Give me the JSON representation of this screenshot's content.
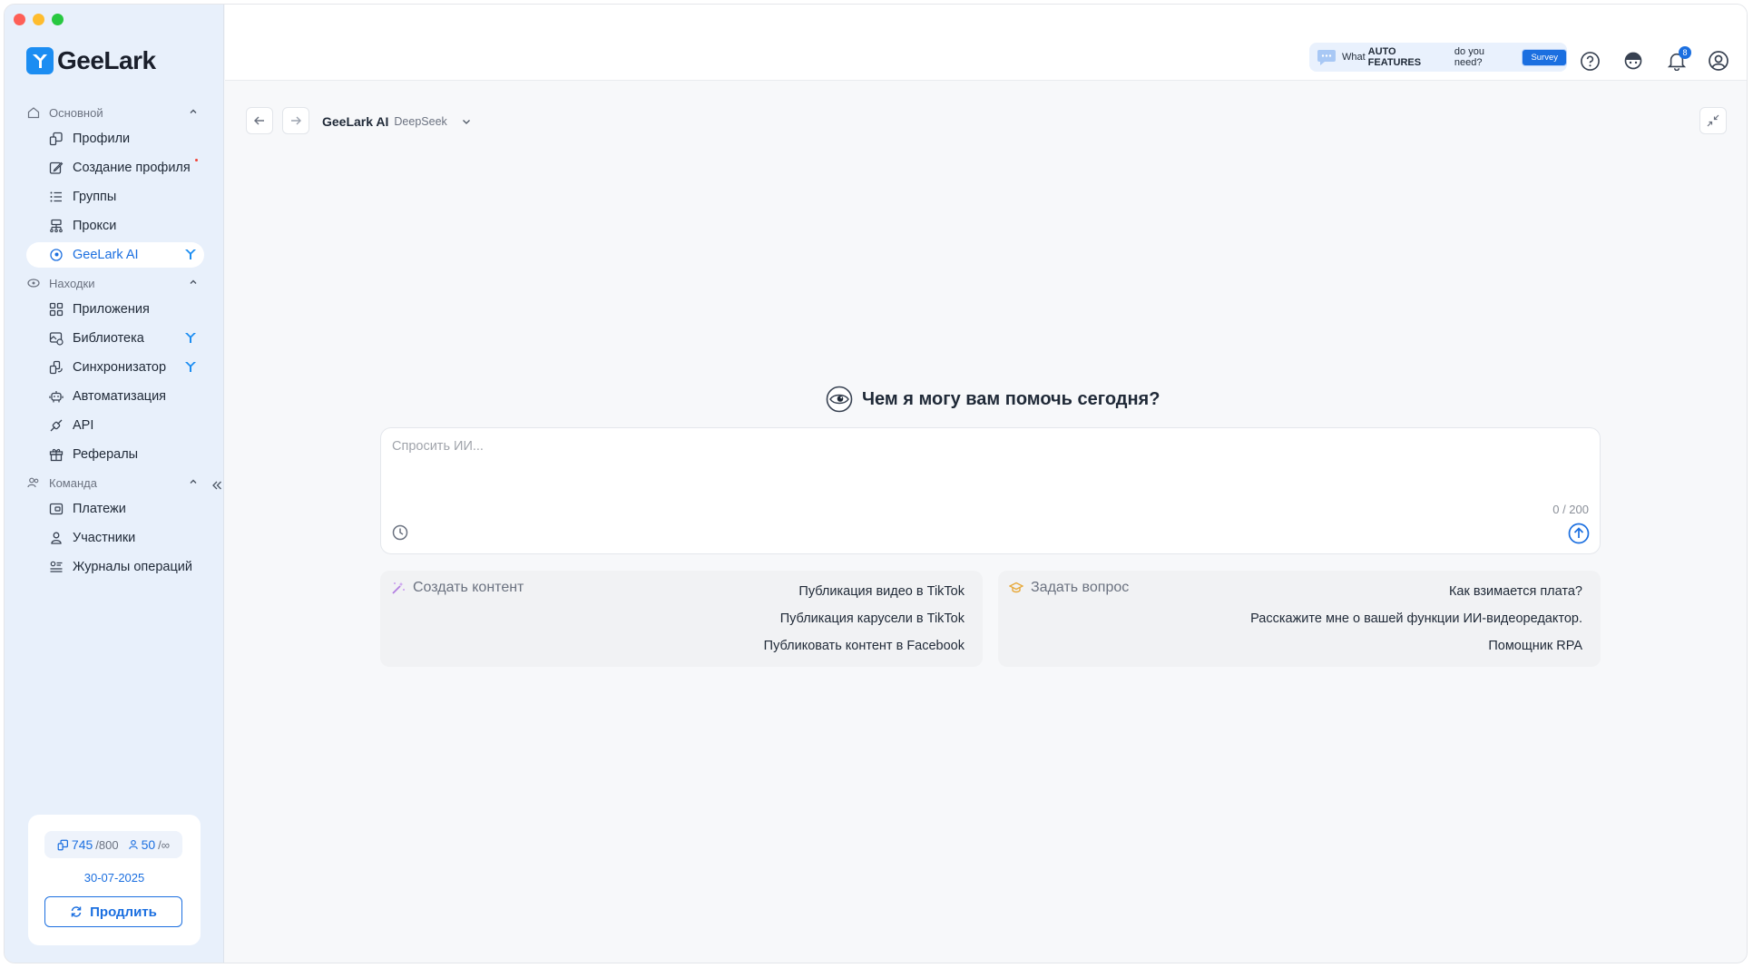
{
  "app": {
    "name": "GeeLark"
  },
  "sidebar": {
    "sections": [
      {
        "label": "Основной"
      },
      {
        "label": "Находки"
      },
      {
        "label": "Команда"
      }
    ],
    "items": [
      {
        "label": "Профили"
      },
      {
        "label": "Создание профиля"
      },
      {
        "label": "Группы"
      },
      {
        "label": "Прокси"
      },
      {
        "label": "GeeLark AI"
      },
      {
        "label": "Приложения"
      },
      {
        "label": "Библиотека"
      },
      {
        "label": "Синхронизатор"
      },
      {
        "label": "Автоматизация"
      },
      {
        "label": "API"
      },
      {
        "label": "Рефералы"
      },
      {
        "label": "Платежи"
      },
      {
        "label": "Участники"
      },
      {
        "label": "Журналы операций"
      }
    ],
    "quota": {
      "profiles_used": "745",
      "profiles_total": "/800",
      "members_used": "50",
      "members_total": "/∞",
      "expiry_date": "30-07-2025",
      "renew_label": "Продлить"
    }
  },
  "topbar": {
    "survey": {
      "prefix": "What",
      "highlight": "AUTO FEATURES",
      "suffix": "do you need?",
      "button": "Survey"
    },
    "notifications_count": "8"
  },
  "breadcrumb": {
    "title": "GeeLark AI",
    "model": "DeepSeek"
  },
  "main": {
    "greeting": "Чем я могу вам помочь сегодня?",
    "prompt_placeholder": "Спросить ИИ...",
    "char_count": "0 / 200",
    "create_content": {
      "title": "Создать контент",
      "items": [
        "Публикация видео в TikTok",
        "Публикация карусели в TikTok",
        "Публиковать контент в Facebook"
      ]
    },
    "ask_question": {
      "title": "Задать вопрос",
      "items": [
        "Как взимается плата?",
        "Расскажите мне о вашей функции ИИ-видеоредактор.",
        "Помощник RPA"
      ]
    }
  }
}
